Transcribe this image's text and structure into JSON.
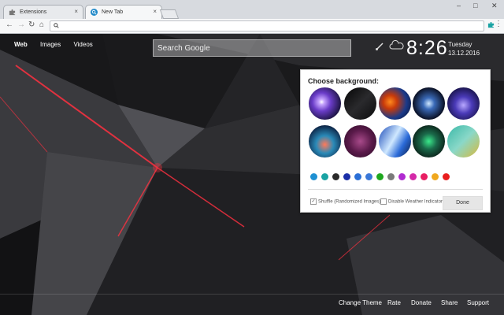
{
  "browser": {
    "tabs": [
      {
        "label": "Extensions",
        "close": "×"
      },
      {
        "label": "New Tab",
        "close": "×"
      }
    ],
    "window_controls": {
      "minimize": "–",
      "maximize": "□",
      "close": "✕"
    },
    "nav": {
      "back": "←",
      "forward": "→",
      "reload": "↻",
      "home": "⌂"
    },
    "menu": "⋮"
  },
  "page": {
    "search_tabs": [
      "Web",
      "Images",
      "Videos"
    ],
    "search_placeholder": "Search Google",
    "clock": {
      "time": "8:26",
      "day": "Tuesday",
      "date": "13.12.2016"
    },
    "panel": {
      "title": "Choose background:",
      "color_swatches": [
        "#1e90d2",
        "#1aa3a3",
        "#2a2a2a",
        "#1b2fa8",
        "#2a6fd6",
        "#3a78d8",
        "#1ea81e",
        "#7a7a7a",
        "#b02ad0",
        "#d42aa8",
        "#e81e63",
        "#f0a81e",
        "#e81e1e"
      ],
      "shuffle_label": "Shuffle (Randomized Images)",
      "weather_label": "Disable Weather Indicator",
      "done_label": "Done"
    },
    "footer": [
      "Change Theme",
      "Rate",
      "Donate",
      "Share",
      "Support"
    ]
  }
}
